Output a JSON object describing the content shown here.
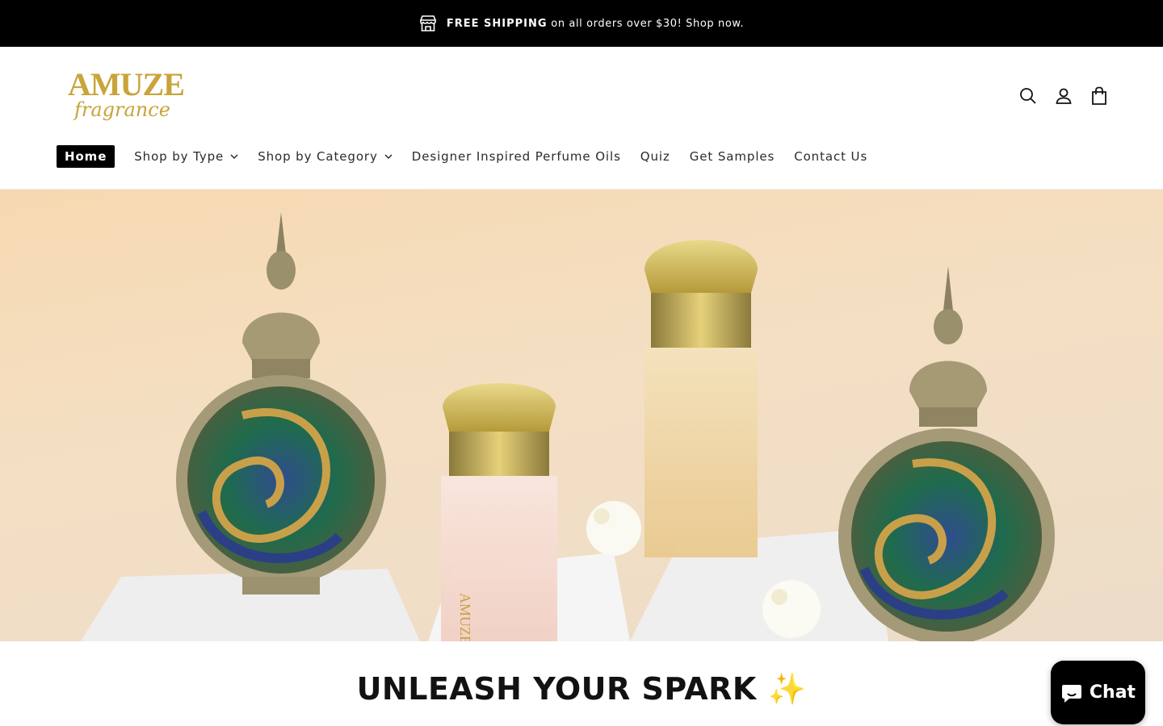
{
  "announcement": {
    "bold": "FREE SHIPPING",
    "text": "on all orders over $30! Shop now.",
    "icon": "store-icon"
  },
  "brand": {
    "name": "AMUZE",
    "tagline": "fragrance",
    "color": "#c9a43a"
  },
  "header_icons": [
    "search-icon",
    "account-icon",
    "cart-icon"
  ],
  "nav": {
    "items": [
      {
        "label": "Home",
        "active": true
      },
      {
        "label": "Shop by Type",
        "dropdown": true
      },
      {
        "label": "Shop by Category",
        "dropdown": true
      },
      {
        "label": "Designer Inspired Perfume Oils"
      },
      {
        "label": "Quiz"
      },
      {
        "label": "Get Samples"
      },
      {
        "label": "Contact Us"
      }
    ]
  },
  "hero": {
    "bottle_brand_text": "AMUZE"
  },
  "headline": "UNLEASH YOUR SPARK ✨",
  "chat": {
    "label": "Chat",
    "icon": "chat-bubble-icon"
  }
}
